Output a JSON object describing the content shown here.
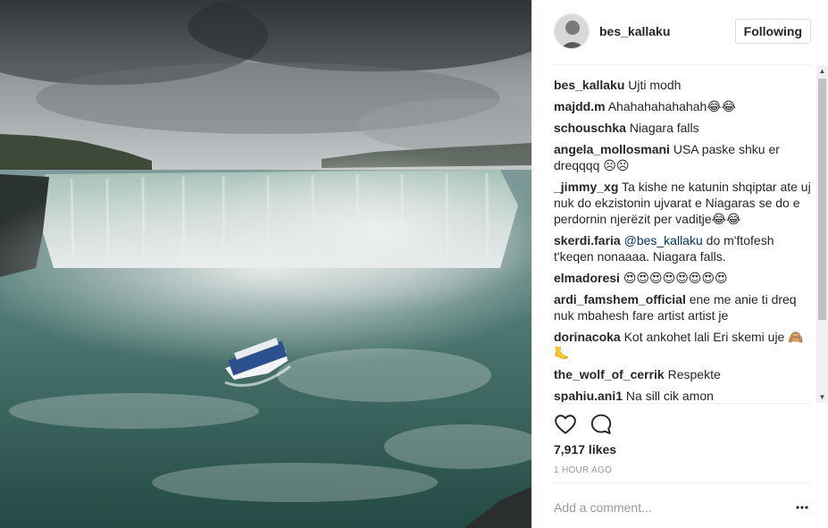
{
  "post": {
    "username": "bes_kallaku",
    "follow_label": "Following",
    "likes": "7,917 likes",
    "time": "1 HOUR AGO",
    "comment_placeholder": "Add a comment..."
  },
  "comments": [
    {
      "user": "bes_kallaku",
      "text": "Ujti modh"
    },
    {
      "user": "majdd.m",
      "text": "Ahahahahahahah😂😂"
    },
    {
      "user": "schouschka",
      "text": "Niagara falls"
    },
    {
      "user": "angela_mollosmani",
      "text": "USA paske shku er dreqqqq ☹☹"
    },
    {
      "user": "_jimmy_xg",
      "text": "Ta kishe ne katunin shqiptar ate uj nuk do ekzistonin ujvarat e Niagaras se do e perdornin njerëzit per vaditje😂😂"
    },
    {
      "user": "skerdi.faria",
      "mention": "@bes_kallaku",
      "text": "do m'ftofesh t'keqen nonaaaa. Niagara falls."
    },
    {
      "user": "elmadoresi",
      "text": "😍😍😍😍😍😍😍😍"
    },
    {
      "user": "ardi_famshem_official",
      "text": "ene me anie ti dreq nuk mbahesh fare artist artist je"
    },
    {
      "user": "dorinacoka",
      "text": "Kot ankohet lali Eri skemi uje 🙈🦶"
    },
    {
      "user": "the_wolf_of_cerrik",
      "text": "Respekte"
    },
    {
      "user": "spahiu.ani1",
      "text": "Na sill cik amon"
    }
  ],
  "icons": {
    "like": "heart-icon",
    "comment": "comment-bubble-icon",
    "more": "more-options-icon"
  },
  "colors": {
    "text": "#262626",
    "muted": "#999999",
    "border": "#efefef",
    "link": "#003569"
  }
}
